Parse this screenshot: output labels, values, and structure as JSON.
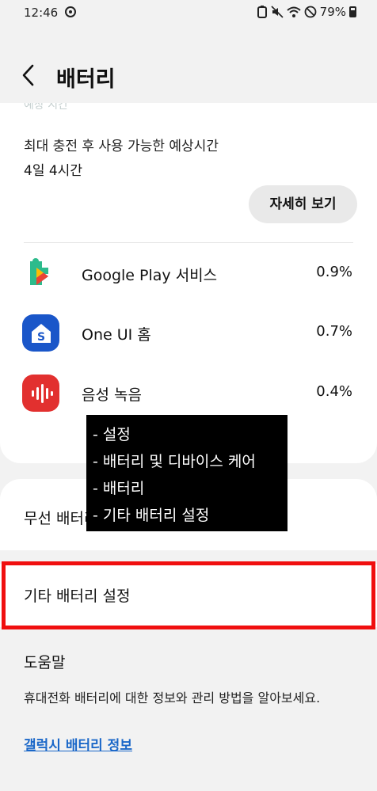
{
  "status_bar": {
    "time": "12:46",
    "sync_icon": "sync-icon",
    "battery_percent": "79%",
    "icons": [
      "battery-saver-icon",
      "mute-icon",
      "wifi-icon",
      "do-not-disturb-icon",
      "battery-icon"
    ]
  },
  "header": {
    "back_icon": "chevron-left-icon",
    "title": "배터리"
  },
  "usage": {
    "faded_text": "예상 시간",
    "estimate_label": "최대 충전 후 사용 가능한 예상시간",
    "estimate_value": "4일 4시간",
    "detail_button": "자세히 보기",
    "apps": [
      {
        "name": "Google Play 서비스",
        "percent": "0.9%",
        "icon": "google-play-services-icon"
      },
      {
        "name": "One UI 홈",
        "percent": "0.7%",
        "icon": "oneui-home-icon",
        "icon_letter": "S"
      },
      {
        "name": "음성 녹음",
        "percent": "0.4%",
        "icon": "voice-recorder-icon"
      }
    ]
  },
  "wireless": {
    "label": "무선 배터리 공유"
  },
  "other_settings": {
    "label": "기타 배터리 설정",
    "highlight_color": "#f00f0f"
  },
  "help": {
    "title": "도움말",
    "description": "휴대전화 배터리에 대한 정보와 관리 방법을 알아보세요.",
    "link": "갤럭시 배터리 정보"
  },
  "overlay": {
    "lines": [
      "- 설정",
      "- 배터리 및 디바이스 케어",
      "- 배터리",
      "- 기타 배터리 설정"
    ]
  },
  "colors": {
    "background": "#f2f2f2",
    "card": "#ffffff",
    "link": "#1a67c8",
    "oneui_blue": "#1a56c9",
    "recorder_red": "#e2302f"
  }
}
